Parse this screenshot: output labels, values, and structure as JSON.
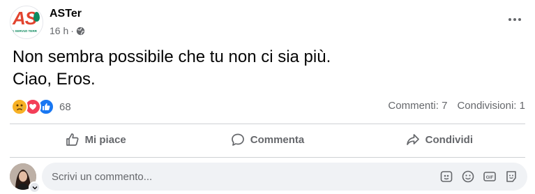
{
  "post": {
    "author": "ASTer",
    "time": "16 h",
    "separator": "·",
    "logo": {
      "text": "AS",
      "subtitle": "A SERVIZI TERR"
    },
    "text_lines": [
      "Non sembra possibile che tu non ci sia più.",
      "Ciao, Eros."
    ],
    "reactions": {
      "icons": [
        "sad-reaction",
        "love-reaction",
        "like-reaction"
      ],
      "count": "68"
    },
    "comments": "Commenti: 7",
    "shares": "Condivisioni: 1"
  },
  "actions": {
    "like": "Mi piace",
    "comment": "Commenta",
    "share": "Condividi"
  },
  "composer": {
    "placeholder": "Scrivi un commento...",
    "tools": [
      "sticker-icon",
      "emoji-icon",
      "gif-icon",
      "avatar-sticker-icon"
    ]
  },
  "colors": {
    "brand_red": "#e2442f",
    "brand_green": "#0e8a5f",
    "like_blue": "#1877f2",
    "secondary_text": "#65676b"
  }
}
